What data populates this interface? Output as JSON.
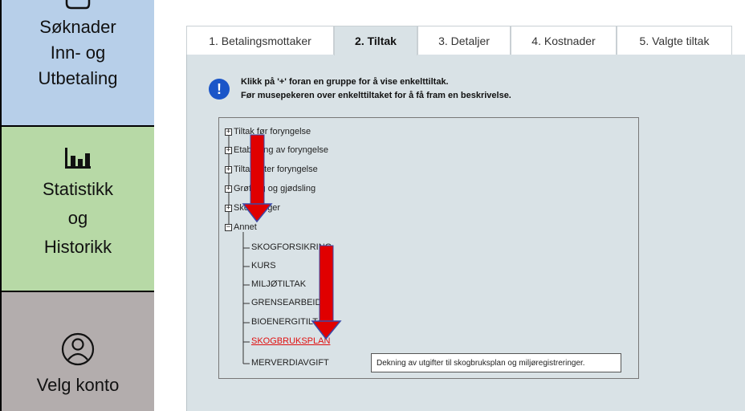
{
  "sidebar": {
    "items": [
      {
        "label": "Søknader\nInn- og\nUtbetaling",
        "icon": "document-icon"
      },
      {
        "label": "Statistikk\nog\nHistorikk",
        "icon": "bar-chart-icon"
      },
      {
        "label": "Velg konto",
        "icon": "user-icon"
      }
    ]
  },
  "tabs": [
    {
      "label": "1. Betalingsmottaker",
      "active": false
    },
    {
      "label": "2. Tiltak",
      "active": true
    },
    {
      "label": "3. Detaljer",
      "active": false
    },
    {
      "label": "4. Kostnader",
      "active": false
    },
    {
      "label": "5. Valgte tiltak",
      "active": false
    }
  ],
  "info": {
    "line1": "Klikk på '+' foran en gruppe for å vise enkelttiltak.",
    "line2": "Før musepekeren over enkelttiltaket for å få fram en beskrivelse."
  },
  "tree": {
    "groups": [
      {
        "label": "Tiltak før foryngelse",
        "expanded": false
      },
      {
        "label": "Etablering av foryngelse",
        "expanded": false
      },
      {
        "label": "Tiltak etter foryngelse",
        "expanded": false
      },
      {
        "label": "Grøfting og gjødsling",
        "expanded": false
      },
      {
        "label": "Skogsveger",
        "expanded": false
      },
      {
        "label": "Annet",
        "expanded": true
      }
    ],
    "annet_items": [
      {
        "label": "SKOGFORSIKRING",
        "highlighted": false
      },
      {
        "label": "KURS",
        "highlighted": false
      },
      {
        "label": "MILJØTILTAK",
        "highlighted": false
      },
      {
        "label": "GRENSEARBEID",
        "highlighted": false
      },
      {
        "label": "BIOENERGITILTAK",
        "highlighted": false
      },
      {
        "label": "SKOGBRUKSPLAN",
        "highlighted": true
      },
      {
        "label": "MERVERDIAVGIFT",
        "highlighted": false
      }
    ]
  },
  "tooltip": {
    "text": "Dekning av utgifter til skogbruksplan og miljøregistreringer."
  },
  "colors": {
    "sidebar_soknader": "#b7cfe9",
    "sidebar_statistikk": "#b7d9a6",
    "sidebar_konto": "#b3adad",
    "panel_bg": "#d9e2e6",
    "info_icon": "#1a55c8",
    "link_highlight": "#e01010",
    "arrow": "#e00000"
  }
}
